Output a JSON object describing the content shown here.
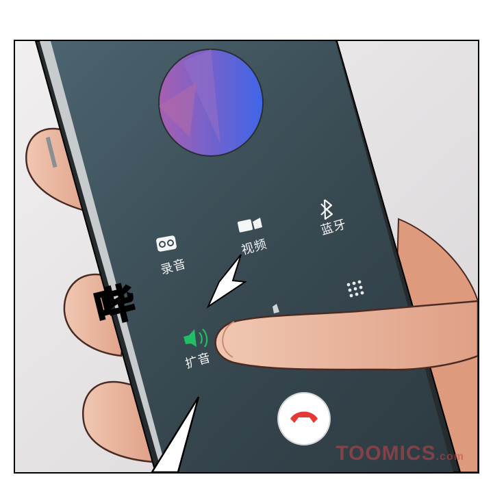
{
  "call_actions": {
    "record": {
      "label": "录音",
      "icon": "voicemail-icon"
    },
    "video": {
      "label": "视频",
      "icon": "video-camera-icon"
    },
    "bluetooth": {
      "label": "蓝牙",
      "icon": "bluetooth-icon"
    },
    "speaker": {
      "label": "扩音",
      "icon": "speaker-icon"
    },
    "keypad": {
      "icon": "keypad-icon"
    },
    "hang_up": {
      "icon": "phone-hangup-icon"
    }
  },
  "sound_effect": "哔",
  "watermark": {
    "brand": "TOOMICS",
    "domain": ".com"
  },
  "colors": {
    "screen": "#3a4a52",
    "speaker_active": "#1fbf63",
    "hang_up": "#e53935",
    "skin": "#e7b49a",
    "avatar": "#6d5fd6"
  }
}
